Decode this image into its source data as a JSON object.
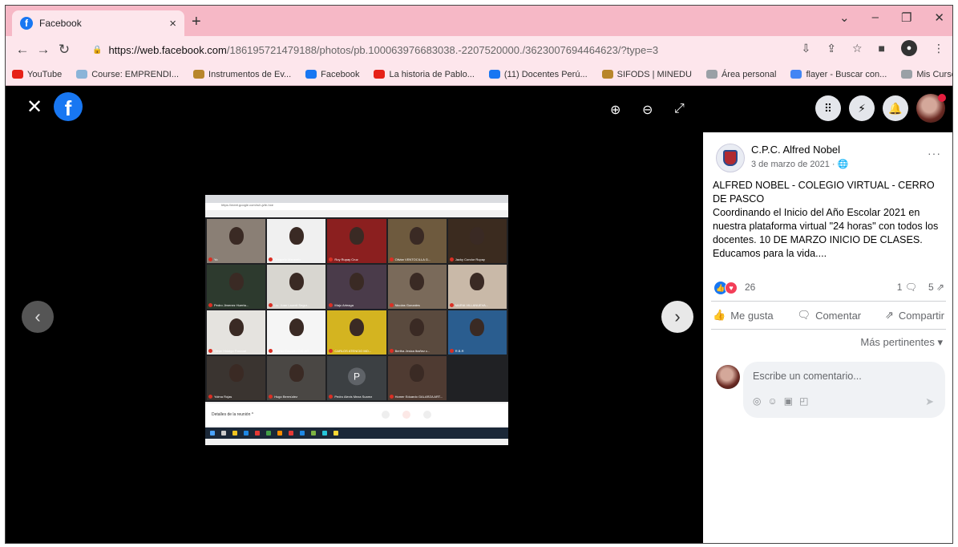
{
  "browser": {
    "tab_title": "Facebook",
    "tab_close": "×",
    "new_tab": "+",
    "url_host": "https://web.facebook.com",
    "url_path": "/186195721479188/photos/pb.100063976683038.-2207520000./3623007694464623/?type=3",
    "bookmarks": [
      {
        "label": "YouTube",
        "color": "#e62117"
      },
      {
        "label": "Course: EMPRENDI...",
        "color": "#8ab4d8"
      },
      {
        "label": "Instrumentos de Ev...",
        "color": "#b8862b"
      },
      {
        "label": "Facebook",
        "color": "#1877f2"
      },
      {
        "label": "La historia de Pablo...",
        "color": "#e62117"
      },
      {
        "label": "(11) Docentes Perú...",
        "color": "#1877f2"
      },
      {
        "label": "SIFODS | MINEDU",
        "color": "#b8862b"
      },
      {
        "label": "Área personal",
        "color": "#9aa0a6"
      },
      {
        "label": "flayer - Buscar con...",
        "color": "#4285f4"
      },
      {
        "label": "Mis Cursos",
        "color": "#9aa0a6"
      }
    ]
  },
  "viewer": {
    "close_glyph": "✕",
    "logo_letter": "f",
    "prev_glyph": "‹",
    "next_glyph": "›"
  },
  "photo": {
    "url_text": "https://meet.google.com/ruh-jzfe-hxe",
    "meeting_details": "Detalles de la reunión  ^",
    "participants": [
      {
        "name": "Yo",
        "bg": "#8a7f75"
      },
      {
        "name": "Gregorio Maravelo",
        "bg": "#f0f0f0"
      },
      {
        "name": "Roy Rupay Cruz",
        "bg": "#8b1f1f"
      },
      {
        "name": "Oliviar VENTOCILLA G...",
        "bg": "#6e5a3e"
      },
      {
        "name": "Jacky Condor Rupay",
        "bg": "#3b2b1f"
      },
      {
        "name": "Pedro Jimenez Huerta...",
        "bg": "#2d3a2e"
      },
      {
        "name": "Lic. Juan Laureli Segur...",
        "bg": "#d8d6d0"
      },
      {
        "name": "Maju Arteaga",
        "bg": "#4a3b4a"
      },
      {
        "name": "Nicolas Gonzales",
        "bg": "#7a6a5a"
      },
      {
        "name": "MARIA VILLANUEVA...",
        "bg": "#c9b9a8"
      },
      {
        "name": "Omar Hidalgo Pascual",
        "bg": "#e5e3df"
      },
      {
        "name": "Homer Eduardo GALAR...",
        "bg": "#f5f5f5"
      },
      {
        "name": "CARLOS ATENCIO MO...",
        "bg": "#d4b420"
      },
      {
        "name": "Bertha Jesica Ibañez c...",
        "bg": "#5a4a3e"
      },
      {
        "name": "R.B.R",
        "bg": "#2a5d8f"
      },
      {
        "name": "Yolma Rojas",
        "bg": "#3a3430"
      },
      {
        "name": "Hugo Bermúdez",
        "bg": "#4a4744"
      },
      {
        "name": "Pedro Alexis Meza Suarez",
        "bg": "#3c4043",
        "initial": "P"
      },
      {
        "name": "Homer Eduardo GALARZA ART...",
        "bg": "#4f3b32"
      },
      {
        "name": "",
        "bg": "#202124"
      }
    ]
  },
  "post": {
    "page_name": "C.P.C. Alfred Nobel",
    "date": "3 de marzo de 2021 · 🌐",
    "more_glyph": "···",
    "text_line1": "ALFRED NOBEL - COLEGIO VIRTUAL - CERRO DE PASCO",
    "text_line2": "Coordinando el Inicio del Año Escolar 2021 en nuestra plataforma virtual \"24 horas\" con todos los docentes. 10 DE MARZO INICIO DE CLASES. Educamos para la vida....",
    "reaction_count": "26",
    "comments_count": "1 🗨",
    "shares_count": "5 ⇗",
    "like_label": "Me gusta",
    "comment_label": "Comentar",
    "share_label": "Compartir",
    "sort_label": "Más pertinentes ▾",
    "comment_placeholder": "Escribe un comentario...",
    "send_glyph": "➤"
  },
  "panel_top": {
    "menu_glyph": "⠿",
    "messenger_glyph": "⚡",
    "bell_glyph": "🔔"
  }
}
